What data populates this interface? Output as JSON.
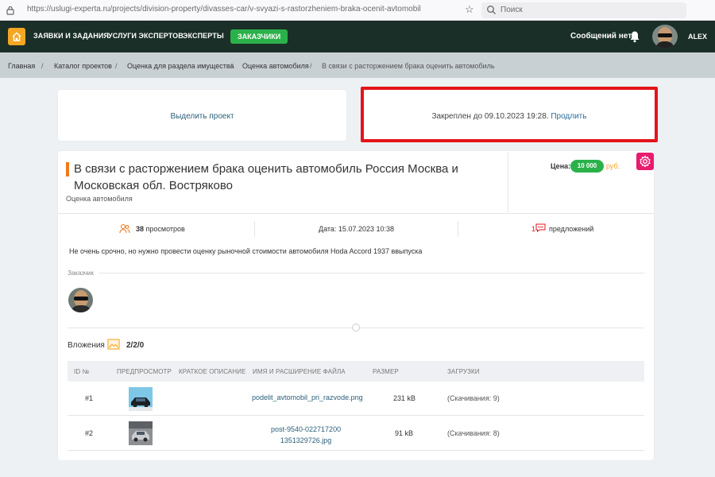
{
  "browser": {
    "url": "https://uslugi-experta.ru/projects/division-property/divasses-car/v-svyazi-s-rastorzheniem-braka-ocenit-avtomobil",
    "search_placeholder": "Поиск"
  },
  "nav": {
    "items": [
      "ЗАЯВКИ И ЗАДАНИЯ",
      "УСЛУГИ ЭКСПЕРТОВ",
      "ЭКСПЕРТЫ"
    ],
    "active": "ЗАКАЗЧИКИ",
    "messages": "Сообщений нет",
    "username": "ALEX"
  },
  "breadcrumbs": [
    "Главная",
    "Каталог проектов",
    "Оценка для раздела имущества",
    "Оценка автомобиля",
    "В связи с расторжением брака оценить автомобиль"
  ],
  "highlight": {
    "label": "Выделить проект"
  },
  "pinned": {
    "text": "Закреплен до 09.10.2023 19:28.",
    "link": "Продлить"
  },
  "project": {
    "title": "В связи с расторжением брака оценить автомобиль Россия Москва и Московская обл. Востряково",
    "category": "Оценка автомобиля",
    "price_label": "Цена:",
    "price": "10 000",
    "currency": "руб.",
    "views_count": "38",
    "views_label": "просмотров",
    "date": "Дата: 15.07.2023 10:38",
    "offers_count": "1",
    "offers_label": "предложений",
    "description": "Не очень срочно, но нужно провести оценку рыночной стоимости автомобиля Hoda Accord 1937 ввыпуска",
    "customer_label": "Заказчик"
  },
  "attachments": {
    "label": "Вложения",
    "count": "2/2/0",
    "headers": [
      "ID №",
      "ПРЕДПРОСМОТР",
      "КРАТКОЕ ОПИСАНИЕ",
      "ИМЯ И РАСШИРЕНИЕ ФАЙЛА",
      "РАЗМЕР",
      "ЗАГРУЗКИ"
    ],
    "rows": [
      {
        "id": "#1",
        "desc": "",
        "filename": "podelit_avtomobil_pri_razvode.png",
        "filename_line2": "",
        "size": "231 kB",
        "downloads": "(Скачивания: 9)"
      },
      {
        "id": "#2",
        "desc": "",
        "filename": "post-9540-022717200",
        "filename_line2": "1351329726.jpg",
        "size": "91 kB",
        "downloads": "(Скачивания: 8)"
      }
    ]
  },
  "colors": {
    "nav_bg": "#1a2f27",
    "accent_orange": "#f5a623",
    "accent_green": "#2bb14a",
    "pin_border": "#e3141b",
    "gear_pink": "#e81c6e"
  }
}
